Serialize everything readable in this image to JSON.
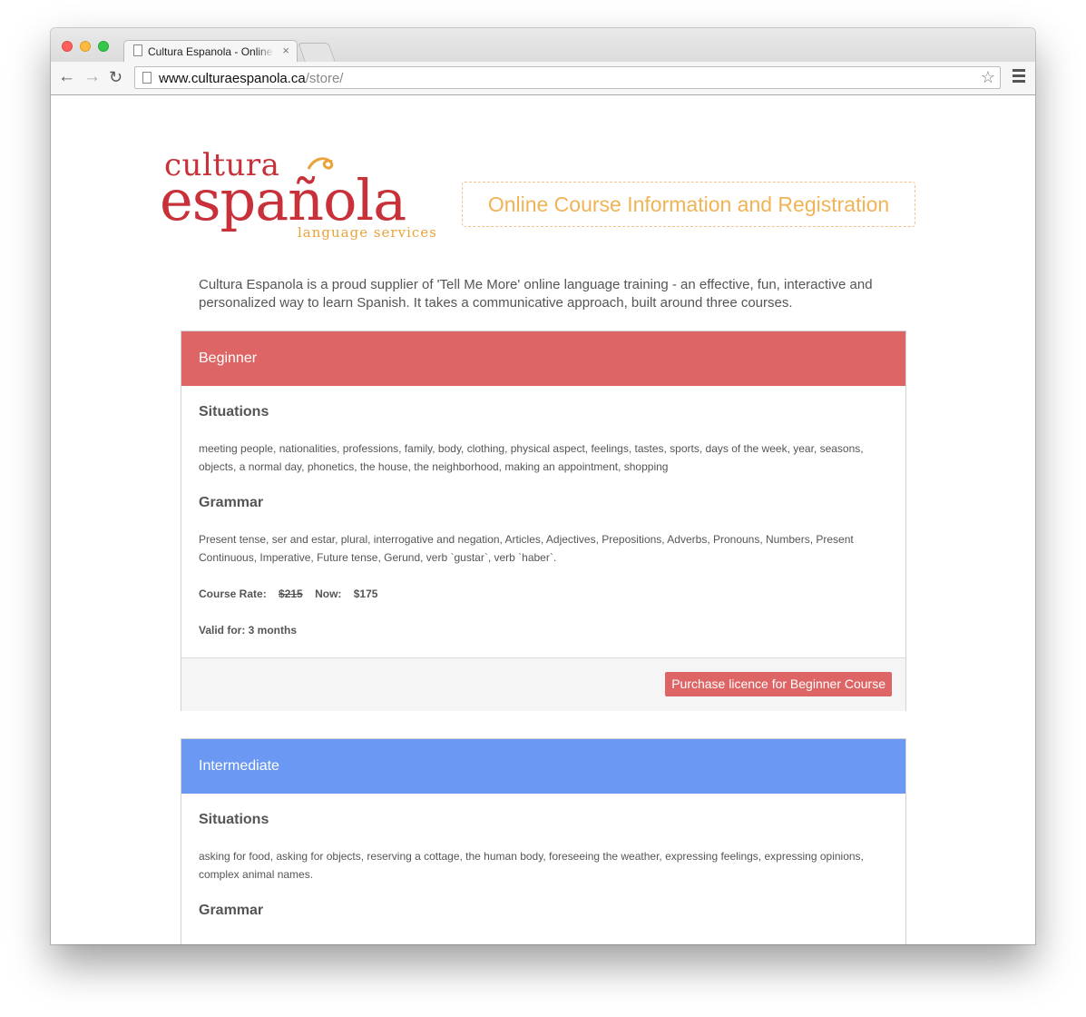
{
  "browser": {
    "tab_title": "Cultura Espanola - Online Course",
    "tab_close": "×",
    "url_host": "www.culturaespanola.ca",
    "url_path": "/store/"
  },
  "logo": {
    "line1": "cultura",
    "line2": "española",
    "line3": "language services"
  },
  "header": {
    "title": "Online Course Information and Registration"
  },
  "intro": "Cultura Espanola is a proud supplier of 'Tell Me More' online language training - an effective, fun, interactive and personalized way to learn Spanish. It takes a communicative approach, built around three courses.",
  "courses": [
    {
      "level": "Beginner",
      "color": "#dd6565",
      "situations_title": "Situations",
      "situations": "meeting people, nationalities, professions, family, body, clothing, physical aspect, feelings, tastes, sports, days of the week, year, seasons, objects, a normal day, phonetics, the house, the neighborhood, making an appointment, shopping",
      "grammar_title": "Grammar",
      "grammar": "Present tense, ser and estar, plural, interrogative and negation, Articles, Adjectives, Prepositions, Adverbs, Pronouns, Numbers, Present Continuous, Imperative, Future tense, Gerund, verb `gustar`, verb `haber`.",
      "rate_label": "Course Rate:",
      "old_price": "$215",
      "now_label": "Now:",
      "new_price": "$175",
      "valid": "Valid for: 3 months",
      "button": "Purchase licence for Beginner Course"
    },
    {
      "level": "Intermediate",
      "color": "#6a98f3",
      "situations_title": "Situations",
      "situations": "asking for food, asking for objects, reserving a cottage, the human body, foreseeing the weather, expressing feelings, expressing opinions, complex animal names.",
      "grammar_title": "Grammar"
    }
  ]
}
